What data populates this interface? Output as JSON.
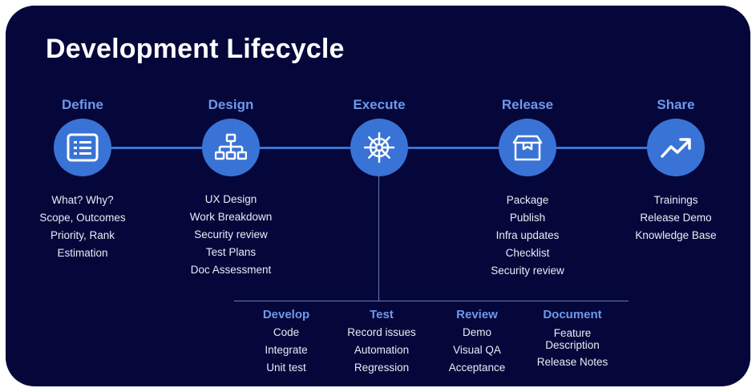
{
  "title": "Development Lifecycle",
  "stages": [
    {
      "title": "Define",
      "icon": "list-icon",
      "items": [
        "What? Why?",
        "Scope, Outcomes",
        "Priority, Rank",
        "Estimation"
      ]
    },
    {
      "title": "Design",
      "icon": "sitemap-icon",
      "items": [
        "UX Design",
        "Work Breakdown",
        "Security review",
        "Test Plans",
        "Doc Assessment"
      ]
    },
    {
      "title": "Execute",
      "icon": "helm-icon",
      "items": []
    },
    {
      "title": "Release",
      "icon": "package-icon",
      "items": [
        "Package",
        "Publish",
        "Infra updates",
        "Checklist",
        "Security review"
      ]
    },
    {
      "title": "Share",
      "icon": "trend-up-icon",
      "items": [
        "Trainings",
        "Release Demo",
        "Knowledge Base"
      ]
    }
  ],
  "execute_substages": [
    {
      "title": "Develop",
      "items": [
        "Code",
        "Integrate",
        "Unit test"
      ]
    },
    {
      "title": "Test",
      "items": [
        "Record issues",
        "Automation",
        "Regression"
      ]
    },
    {
      "title": "Review",
      "items": [
        "Demo",
        "Visual QA",
        "Acceptance"
      ]
    },
    {
      "title": "Document",
      "items": [
        "Feature Description",
        "Release Notes"
      ]
    }
  ],
  "colors": {
    "background": "#05073a",
    "accent": "#3a73d6",
    "heading": "#6f98ea",
    "text": "#e9ecf6"
  }
}
